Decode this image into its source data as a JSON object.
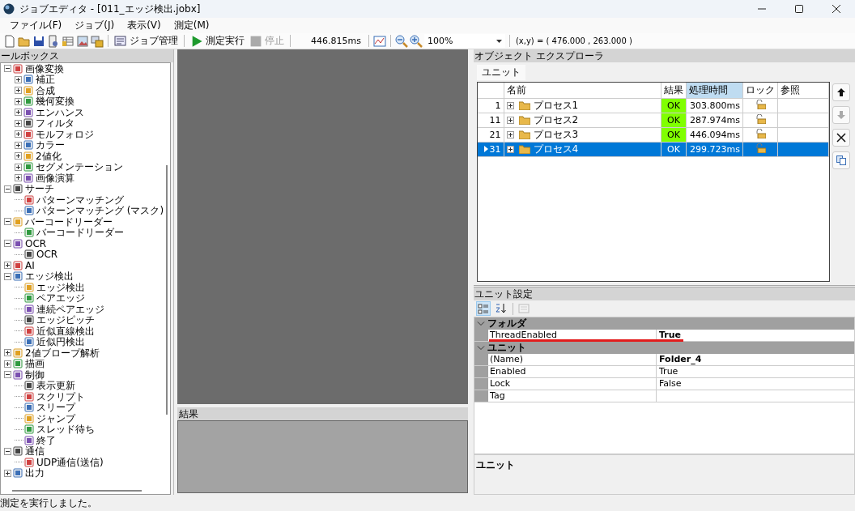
{
  "window": {
    "title": "ジョブエディタ - [011_エッジ検出.jobx]"
  },
  "menu": [
    "ファイル(F)",
    "ジョブ(J)",
    "表示(V)",
    "測定(M)"
  ],
  "toolbar": {
    "job_button": "ジョブ管理",
    "run_button": {
      "label": "測定実行",
      "disabled": false
    },
    "stop_button": {
      "label": "停止",
      "disabled": true
    },
    "time": "446.815ms",
    "zoom": "100%",
    "coords": "(x,y) = ( 476.000 , 263.000 )"
  },
  "toolbox": {
    "title": "ールボックス",
    "items": [
      {
        "label": "画像変換",
        "expanded": true,
        "children": [
          {
            "label": "補正",
            "expanded": false
          },
          {
            "label": "合成",
            "expanded": false
          },
          {
            "label": "幾何変換",
            "expanded": false
          },
          {
            "label": "エンハンス",
            "expanded": false
          },
          {
            "label": "フィルタ",
            "expanded": false
          },
          {
            "label": "モルフォロジ",
            "expanded": false
          },
          {
            "label": "カラー",
            "expanded": false
          },
          {
            "label": "2値化",
            "expanded": false
          },
          {
            "label": "セグメンテーション",
            "expanded": false
          },
          {
            "label": "画像演算",
            "expanded": false
          }
        ]
      },
      {
        "label": "サーチ",
        "expanded": true,
        "children": [
          {
            "label": "パターンマッチング"
          },
          {
            "label": "パターンマッチング (マスク)"
          }
        ]
      },
      {
        "label": "バーコードリーダー",
        "expanded": true,
        "children": [
          {
            "label": "バーコードリーダー"
          }
        ]
      },
      {
        "label": "OCR",
        "expanded": true,
        "children": [
          {
            "label": "OCR"
          }
        ]
      },
      {
        "label": "AI",
        "expanded": false
      },
      {
        "label": "エッジ検出",
        "expanded": true,
        "children": [
          {
            "label": "エッジ検出"
          },
          {
            "label": "ペアエッジ"
          },
          {
            "label": "連続ペアエッジ"
          },
          {
            "label": "エッジピッチ"
          },
          {
            "label": "近似直線検出"
          },
          {
            "label": "近似円検出"
          }
        ]
      },
      {
        "label": "2値ブロープ解析",
        "expanded": false
      },
      {
        "label": "描画",
        "expanded": false
      },
      {
        "label": "制御",
        "expanded": true,
        "children": [
          {
            "label": "表示更新"
          },
          {
            "label": "スクリプト"
          },
          {
            "label": "スリープ"
          },
          {
            "label": "ジャンプ"
          },
          {
            "label": "スレッド待ち"
          },
          {
            "label": "終了"
          }
        ]
      },
      {
        "label": "通信",
        "expanded": true,
        "children": [
          {
            "label": "UDP通信(送信)"
          }
        ]
      },
      {
        "label": "出力",
        "expanded": false
      }
    ]
  },
  "result_panel": {
    "title": "結果"
  },
  "object_explorer": {
    "title": "オブジェクト エクスプローラ",
    "tabs": [
      {
        "label": "ユニット",
        "selected": true
      }
    ],
    "columns": [
      {
        "label": "名前",
        "selected": false
      },
      {
        "label": "結果",
        "selected": false
      },
      {
        "label": "処理時間",
        "selected": true
      },
      {
        "label": "ロック",
        "selected": false
      },
      {
        "label": "参照",
        "selected": false
      }
    ],
    "rows": [
      {
        "number": "1",
        "name": "プロセス1",
        "result": "OK",
        "color": "#80ff00",
        "time": "303.800ms",
        "locked": false,
        "expanded": false,
        "selected": false
      },
      {
        "number": "11",
        "name": "プロセス2",
        "result": "OK",
        "color": "#80ff00",
        "time": "287.974ms",
        "locked": false,
        "expanded": false,
        "selected": false
      },
      {
        "number": "21",
        "name": "プロセス3",
        "result": "OK",
        "color": "#80ff00",
        "time": "446.094ms",
        "locked": false,
        "expanded": false,
        "selected": false
      },
      {
        "number": "31",
        "name": "プロセス4",
        "result": "OK",
        "time": "299.723ms",
        "locked": false,
        "expanded": false,
        "selected": true
      }
    ],
    "side_buttons": [
      {
        "kind": "up",
        "disabled": false
      },
      {
        "kind": "down",
        "disabled": true
      },
      {
        "kind": "delete",
        "disabled": false
      },
      {
        "kind": "copy",
        "disabled": false
      }
    ]
  },
  "unit_settings": {
    "title": "ユニット設定",
    "sort_buttons": [
      {
        "kind": "categorized",
        "selected": true
      },
      {
        "kind": "alphabetical",
        "selected": false
      }
    ],
    "categories": [
      {
        "label": "フォルダ",
        "expanded": true,
        "properties": [
          {
            "name": "ThreadEnabled",
            "value": "True",
            "bold": true,
            "underlined": true
          }
        ]
      },
      {
        "label": "ユニット",
        "expanded": true,
        "properties": [
          {
            "name": "(Name)",
            "value": "Folder_4",
            "bold": true,
            "underlined": false
          },
          {
            "name": "Enabled",
            "value": "True",
            "bold": false,
            "underlined": false
          },
          {
            "name": "Lock",
            "value": "False",
            "bold": false,
            "underlined": false
          },
          {
            "name": "Tag",
            "underlined": false
          }
        ]
      }
    ],
    "description": "ユニット"
  },
  "status_bar": "測定を実行しました。"
}
